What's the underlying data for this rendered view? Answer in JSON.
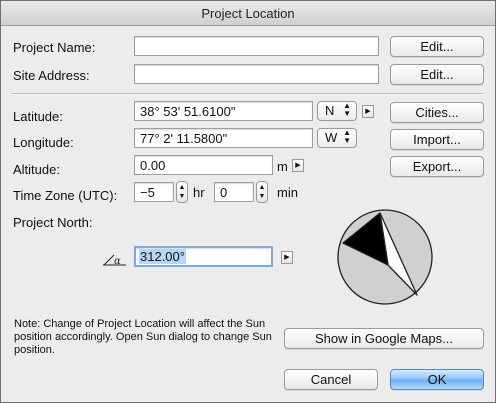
{
  "window": {
    "title": "Project Location"
  },
  "project_name": {
    "label": "Project Name:",
    "value": "",
    "edit_label": "Edit..."
  },
  "site_address": {
    "label": "Site Address:",
    "value": "",
    "edit_label": "Edit..."
  },
  "latitude": {
    "label": "Latitude:",
    "value": "38° 53' 51.6100\"",
    "hemisphere": "N"
  },
  "longitude": {
    "label": "Longitude:",
    "value": "77° 2' 11.5800\"",
    "hemisphere": "W"
  },
  "altitude": {
    "label": "Altitude:",
    "value": "0.00",
    "unit": "m"
  },
  "time_zone": {
    "label": "Time Zone (UTC):",
    "hours": "−5",
    "hours_unit": "hr",
    "minutes": "0",
    "minutes_unit": "min"
  },
  "project_north": {
    "label": "Project North:",
    "value": "312.00°",
    "icon": "angle-alpha-icon"
  },
  "buttons": {
    "cities": "Cities...",
    "import": "Import...",
    "export": "Export...",
    "google_maps": "Show in Google Maps...",
    "cancel": "Cancel",
    "ok": "OK"
  },
  "note": "Note: Change of Project Location will affect the Sun position accordingly. Open Sun dialog to change Sun position.",
  "colors": {
    "ok_button": "#6aaef2",
    "selection": "#b5d5fb",
    "compass_disc": "#d0d0d0"
  }
}
